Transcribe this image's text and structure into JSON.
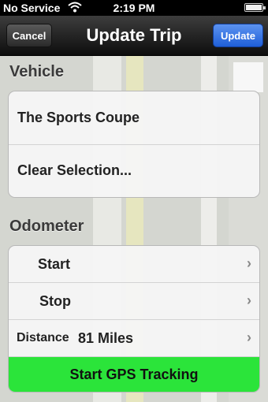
{
  "status_bar": {
    "carrier": "No Service",
    "time": "2:19 PM",
    "wifi_icon": "wifi-icon",
    "battery_icon": "battery-icon"
  },
  "nav": {
    "title": "Update Trip",
    "cancel_label": "Cancel",
    "update_label": "Update",
    "update_color": "#2d6fe0"
  },
  "vehicle": {
    "header": "Vehicle",
    "rows": [
      "The Sports Coupe",
      "Clear Selection..."
    ]
  },
  "odometer": {
    "header": "Odometer",
    "start_label": "Start",
    "stop_label": "Stop",
    "distance_label": "Distance",
    "distance_value": "81 Miles",
    "chevron_icon": "chevron-right-icon"
  },
  "gps": {
    "label": "Start GPS Tracking",
    "color": "#2be43a"
  }
}
